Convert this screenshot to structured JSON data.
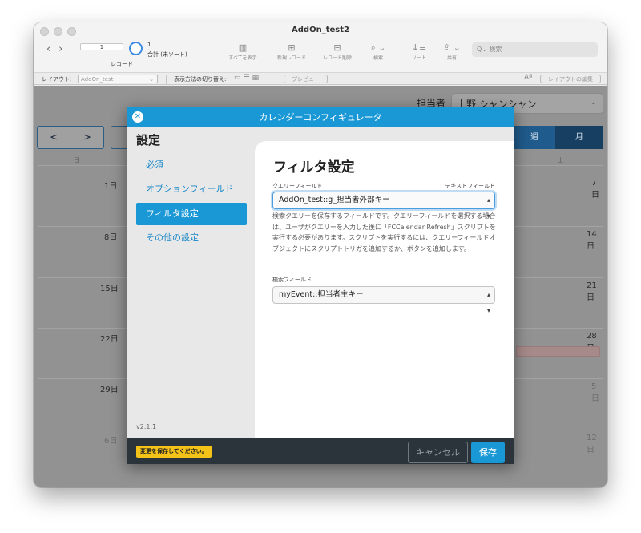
{
  "window": {
    "title": "AddOn_test2"
  },
  "toolbar": {
    "record_current": "1",
    "record_label": "レコード",
    "total_count": "1",
    "total_label": "合計 (未ソート)",
    "show_all": "すべてを表示",
    "new_record": "新規レコード",
    "delete_record": "レコード削除",
    "find": "検索",
    "sort": "ソート",
    "share": "共有",
    "search_placeholder": "検索"
  },
  "layout_bar": {
    "layout_label": "レイアウト:",
    "layout_value": "AddOn_test",
    "view_as_label": "表示方法の切り替え:",
    "preview": "プレビュー",
    "aa": "Aª",
    "edit_layout": "レイアウトの編集"
  },
  "background": {
    "assignee_label": "担当者",
    "assignee_value": "上野 シャンシャン",
    "prev_glyph": "<",
    "next_glyph": ">",
    "view_week": "週",
    "view_month": "月",
    "weekday_sun": "日",
    "weekday_sat": "土",
    "left_dates": [
      "1日",
      "8日",
      "15日",
      "22日",
      "29日",
      "6日"
    ],
    "right_dates": [
      "7日",
      "14日",
      "21日",
      "28日",
      "5日",
      "12日"
    ]
  },
  "modal": {
    "title": "カレンダーコンフィギュレータ",
    "sidebar": {
      "title": "設定",
      "items": [
        {
          "label": "必須"
        },
        {
          "label": "オプションフィールド"
        },
        {
          "label": "フィルタ設定"
        },
        {
          "label": "その他の設定"
        }
      ],
      "version": "v2.1.1"
    },
    "panel": {
      "title": "フィルタ設定",
      "query_field_label": "クエリーフィールド",
      "query_field_type": "テキストフィールド",
      "query_field_value": "AddOn_test::g_担当者外部キー",
      "help_text": "検索クエリーを保存するフィールドです。クエリーフィールドを選択する場合は、ユーザがクエリーを入力した後に「FCCalendar Refresh」スクリプトを実行する必要があります。スクリプトを実行するには、クエリーフィールドオブジェクトにスクリプトトリガを追加するか、ボタンを追加します。",
      "search_field_label": "検索フィールド",
      "search_field_value": "myEvent::担当者主キー"
    },
    "footer": {
      "warning": "変更を保存してください。",
      "cancel": "キャンセル",
      "save": "保存"
    }
  }
}
